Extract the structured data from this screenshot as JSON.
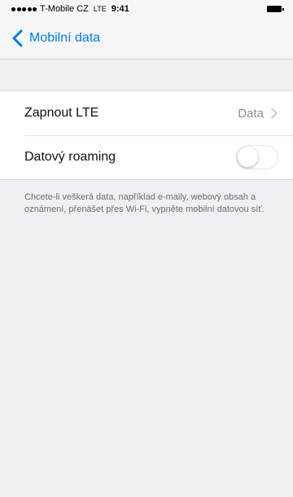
{
  "status_bar": {
    "carrier": "T-Mobile CZ",
    "network": "LTE",
    "time": "9:41",
    "icons": [
      "signal-icon",
      "battery-icon"
    ]
  },
  "nav": {
    "back_label": "Mobilní data",
    "back_icon": "chevron-left-icon"
  },
  "settings": {
    "rows": [
      {
        "label": "Zapnout LTE",
        "value": "Data",
        "accessory": "chevron-right-icon"
      },
      {
        "label": "Datový roaming",
        "toggle_state": "off"
      }
    ]
  },
  "footer_note": "Chcete-li veškerá data, například e-maily, webový obsah a oznámení, přenášet přes Wi-Fi, vypněte mobilní datovou síť.",
  "colors": {
    "accent": "#007aff",
    "background": "#efeff4",
    "secondary_text": "#8e8e93"
  }
}
